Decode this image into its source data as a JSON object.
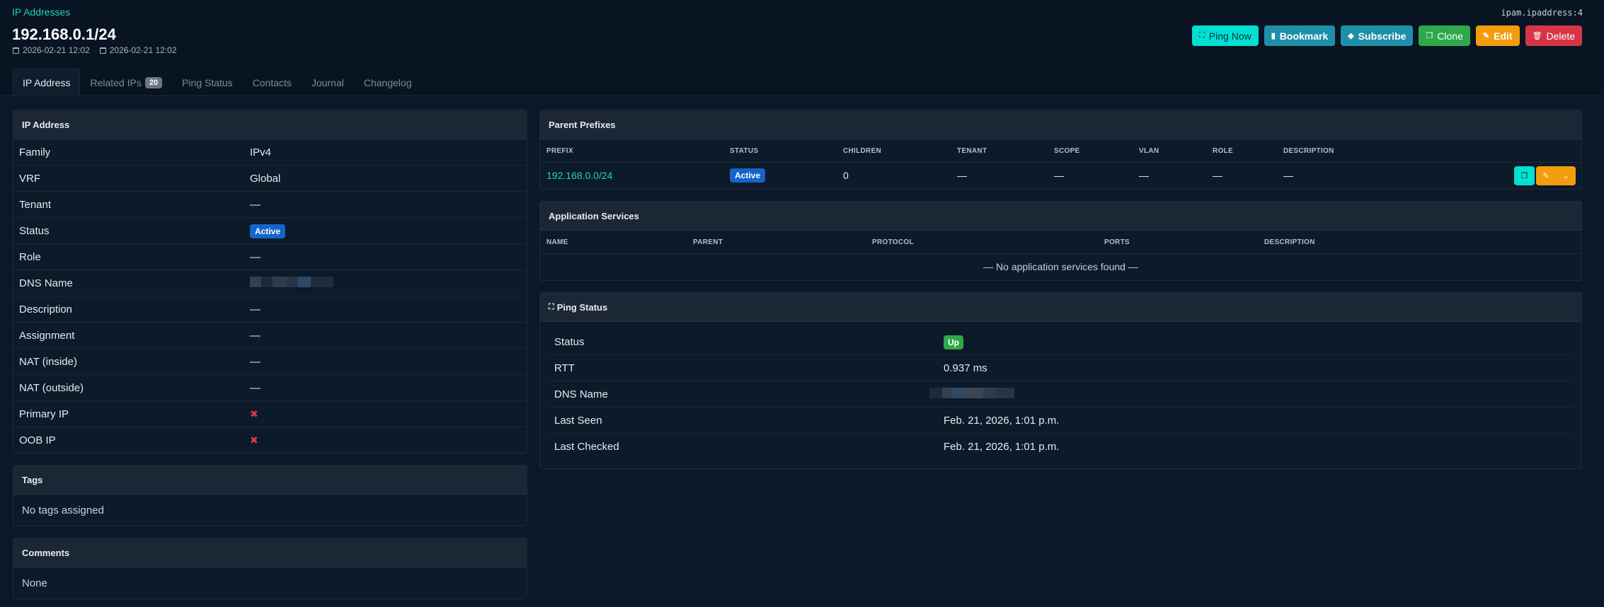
{
  "header": {
    "breadcrumb": "IP Addresses",
    "object_id": "ipam.ipaddress:4",
    "title": "192.168.0.1/24",
    "created": "2026-02-21 12:02",
    "updated": "2026-02-21 12:02"
  },
  "actions": {
    "ping": "Ping Now",
    "bookmark": "Bookmark",
    "subscribe": "Subscribe",
    "clone": "Clone",
    "edit": "Edit",
    "delete": "Delete"
  },
  "tabs": [
    {
      "label": "IP Address"
    },
    {
      "label": "Related IPs",
      "count": "20"
    },
    {
      "label": "Ping Status"
    },
    {
      "label": "Contacts"
    },
    {
      "label": "Journal"
    },
    {
      "label": "Changelog"
    }
  ],
  "ip_card": {
    "title": "IP Address",
    "rows": [
      {
        "key": "Family",
        "value": "IPv4"
      },
      {
        "key": "VRF",
        "value": "Global"
      },
      {
        "key": "Tenant",
        "value": "—"
      },
      {
        "key": "Status",
        "value": "Active"
      },
      {
        "key": "Role",
        "value": "—"
      },
      {
        "key": "DNS Name",
        "value": ""
      },
      {
        "key": "Description",
        "value": "—"
      },
      {
        "key": "Assignment",
        "value": "—"
      },
      {
        "key": "NAT (inside)",
        "value": "—"
      },
      {
        "key": "NAT (outside)",
        "value": "—"
      },
      {
        "key": "Primary IP",
        "value": "✖"
      },
      {
        "key": "OOB IP",
        "value": "✖"
      }
    ]
  },
  "tags_card": {
    "title": "Tags",
    "body": "No tags assigned"
  },
  "comments_card": {
    "title": "Comments",
    "body": "None"
  },
  "prefixes_card": {
    "title": "Parent Prefixes",
    "columns": [
      "PREFIX",
      "STATUS",
      "CHILDREN",
      "TENANT",
      "SCOPE",
      "VLAN",
      "ROLE",
      "DESCRIPTION"
    ],
    "row": {
      "prefix": "192.168.0.0/24",
      "status": "Active",
      "children": "0",
      "tenant": "—",
      "scope": "—",
      "vlan": "—",
      "role": "—",
      "description": "—"
    }
  },
  "services_card": {
    "title": "Application Services",
    "columns": [
      "NAME",
      "PARENT",
      "PROTOCOL",
      "PORTS",
      "DESCRIPTION"
    ],
    "empty": "— No application services found —"
  },
  "ping_card": {
    "title": "Ping Status",
    "rows": [
      {
        "key": "Status",
        "value": "Up"
      },
      {
        "key": "RTT",
        "value": "0.937 ms"
      },
      {
        "key": "DNS Name",
        "value": ""
      },
      {
        "key": "Last Seen",
        "value": "Feb. 21, 2026, 1:01 p.m."
      },
      {
        "key": "Last Checked",
        "value": "Feb. 21, 2026, 1:01 p.m."
      }
    ]
  },
  "colors": {
    "accent": "#22d3b8",
    "active_badge": "#1565c8",
    "up_badge": "#2ea84a",
    "danger": "#d63545",
    "warning": "#f29d0c"
  }
}
